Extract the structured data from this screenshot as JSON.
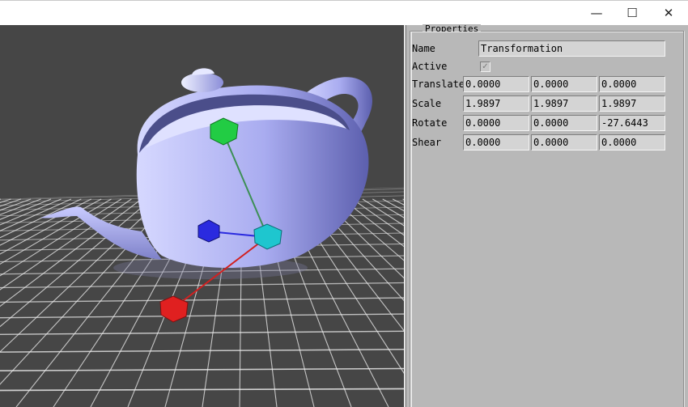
{
  "window": {
    "minimize_glyph": "—",
    "maximize_glyph": "☐",
    "close_glyph": "✕"
  },
  "viewport": {
    "background_color": "#464646",
    "grid_color": "#f0f0f0",
    "teapot_color": "#a7aaf0",
    "gizmo": {
      "x_axis_color": "#e02020",
      "y_axis_color": "#22cc44",
      "z_axis_color": "#2a2adf",
      "center_color": "#1ec6cf"
    }
  },
  "properties": {
    "title": "Properties",
    "name_label": "Name",
    "name_value": "Transformation",
    "active_label": "Active",
    "active_checked": true,
    "rows": [
      {
        "label": "Translate",
        "values": [
          "0.0000",
          "0.0000",
          "0.0000"
        ]
      },
      {
        "label": "Scale",
        "values": [
          "1.9897",
          "1.9897",
          "1.9897"
        ]
      },
      {
        "label": "Rotate",
        "values": [
          "0.0000",
          "0.0000",
          "-27.6443"
        ]
      },
      {
        "label": "Shear",
        "values": [
          "0.0000",
          "0.0000",
          "0.0000"
        ]
      }
    ]
  }
}
